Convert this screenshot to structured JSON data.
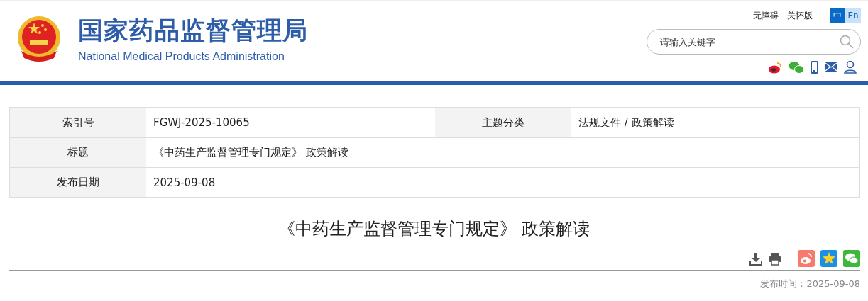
{
  "header": {
    "title": "国家药品监督管理局",
    "subtitle": "National Medical Products Administration",
    "links": [
      "无障碍",
      "关怀版"
    ],
    "languages": [
      {
        "label": "中",
        "selected": true
      },
      {
        "label": "En",
        "selected": false
      }
    ],
    "search": {
      "placeholder": "请输入关键字"
    }
  },
  "info_table": {
    "rows": [
      {
        "cells": [
          {
            "label": "索引号",
            "value": "FGWJ-2025-10065"
          },
          {
            "label": "主题分类",
            "value": "法规文件 / 政策解读"
          }
        ]
      },
      {
        "cells": [
          {
            "label": "标题",
            "value": "《中药生产监督管理专门规定》 政策解读"
          }
        ]
      },
      {
        "cells": [
          {
            "label": "发布日期",
            "value": "2025-09-08"
          }
        ]
      }
    ]
  },
  "article": {
    "title": "《中药生产监督管理专门规定》 政策解读",
    "publish_label": "发布时间：",
    "publish_date": "2025-09-08"
  }
}
